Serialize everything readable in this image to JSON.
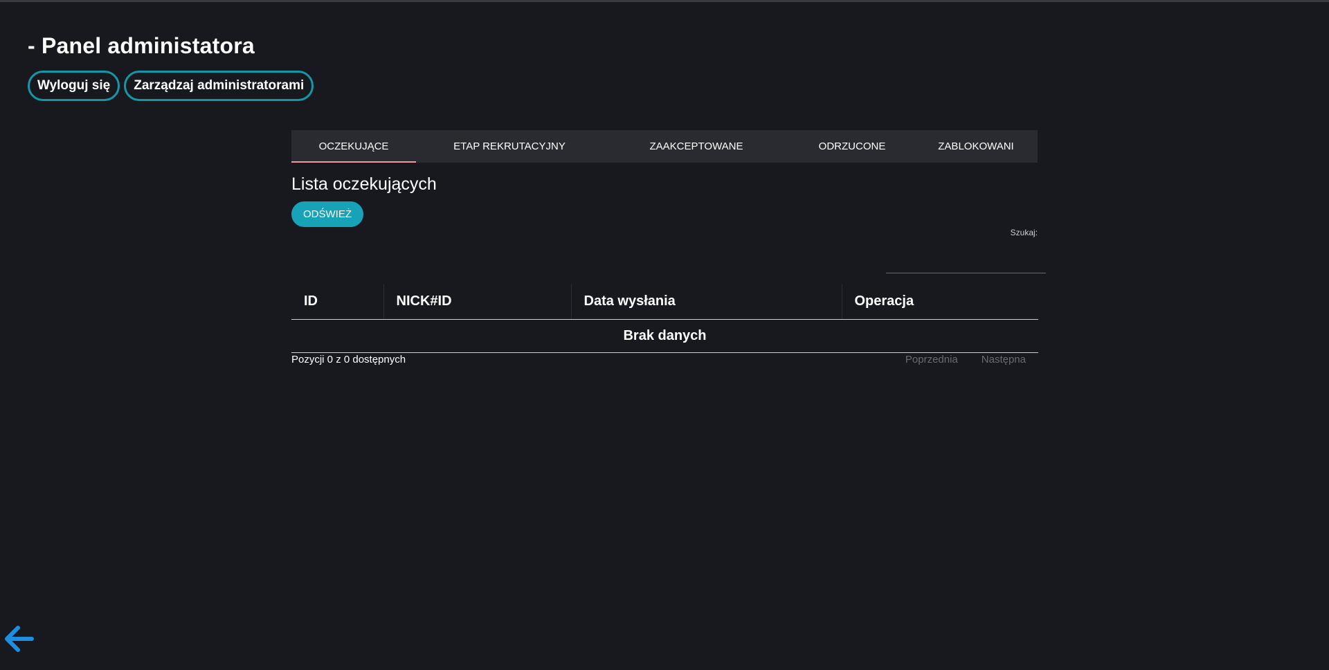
{
  "header": {
    "title": "- Panel administatora",
    "logout_label": "Wyloguj się",
    "manage_admins_label": "Zarządzaj administratorami"
  },
  "tabs": [
    {
      "label": "OCZEKUJĄCE",
      "active": true
    },
    {
      "label": "ETAP REKRUTACYJNY",
      "active": false
    },
    {
      "label": "ZAAKCEPTOWANE",
      "active": false
    },
    {
      "label": "ODRZUCONE",
      "active": false
    },
    {
      "label": "ZABLOKOWANI",
      "active": false
    }
  ],
  "main": {
    "list_title": "Lista oczekujących",
    "refresh_label": "ODŚWIEŻ",
    "search_label": "Szukaj:",
    "search_value": ""
  },
  "table": {
    "columns": [
      "ID",
      "NICK#ID",
      "Data wysłania",
      "Operacja"
    ],
    "empty_text": "Brak danych"
  },
  "footer": {
    "info_text": "Pozycji 0 z 0 dostępnych",
    "prev_label": "Poprzednia",
    "next_label": "Następna"
  },
  "icons": {
    "back": "arrow-left-icon"
  },
  "colors": {
    "background": "#18191f",
    "accent": "#17a2b8",
    "active_tab_underline": "#f29aa0",
    "back_arrow": "#1e8fe0"
  }
}
